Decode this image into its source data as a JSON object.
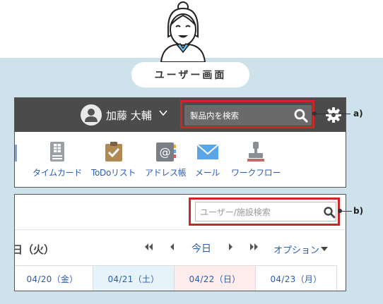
{
  "view_label": "ユーザー画面",
  "header": {
    "user_name": "加藤 大輔",
    "search_placeholder": "製品内を検索",
    "icons": [
      "user-avatar-icon",
      "chevron-down-icon",
      "search-icon",
      "gear-icon"
    ]
  },
  "apps": [
    {
      "label": "モ",
      "icon": "memo-icon"
    },
    {
      "label": "タイムカード",
      "icon": "timecard-icon"
    },
    {
      "label": "ToDoリスト",
      "icon": "todo-icon"
    },
    {
      "label": "アドレス帳",
      "icon": "address-book-icon"
    },
    {
      "label": "メール",
      "icon": "mail-icon"
    },
    {
      "label": "ワークフロー",
      "icon": "workflow-icon"
    }
  ],
  "callouts": {
    "a": "a)",
    "b": "b)"
  },
  "schedule": {
    "search_placeholder": "ユーザー/施設検索",
    "date_heading": "日（火）",
    "today_label": "今日",
    "option_label": "オプション",
    "days": [
      "04/20（金）",
      "04/21（土）",
      "04/22（日）",
      "04/23（月）"
    ]
  },
  "colors": {
    "background_band": "#cde2ea",
    "header_bar": "#4b4b4b",
    "link": "#2a5db0",
    "callout": "#cc2727",
    "saturday": "#e6f3fb",
    "sunday": "#fcecec"
  }
}
